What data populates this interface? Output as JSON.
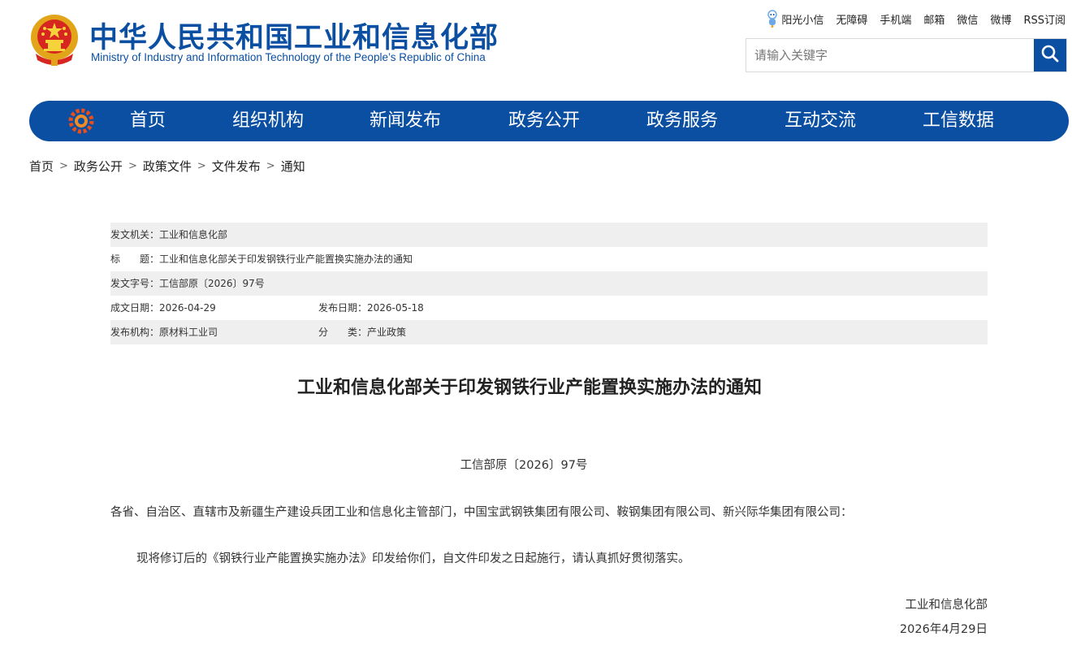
{
  "header": {
    "title": "中华人民共和国工业和信息化部",
    "subtitle": "Ministry of Industry and Information Technology of the People’s Republic of China",
    "toplinks": [
      "阳光小信",
      "无障碍",
      "手机端",
      "邮箱",
      "微信",
      "微博",
      "RSS订阅"
    ],
    "search_placeholder": "请输入关键字",
    "brand_color": "#0b4fa3"
  },
  "nav": {
    "items": [
      "首页",
      "组织机构",
      "新闻发布",
      "政务公开",
      "政务服务",
      "互动交流",
      "工信数据"
    ]
  },
  "breadcrumb": [
    "首页",
    "政务公开",
    "政策文件",
    "文件发布",
    "通知"
  ],
  "breadcrumb_separator": ">",
  "meta": {
    "issuer": "发文机关：工业和信息化部",
    "title": "标　　题：工业和信息化部关于印发钢铁行业产能置换实施办法的通知",
    "doc_no": "发文字号：工信部原〔2026〕97号",
    "created": "成文日期：2026-04-29",
    "published": "发布日期：2026-05-18",
    "org": "发布机构：原材料工业司",
    "category": "分　　类：产业政策"
  },
  "document": {
    "title": "工业和信息化部关于印发钢铁行业产能置换实施办法的通知",
    "number": "工信部原〔2026〕97号",
    "recipients": "各省、自治区、直辖市及新疆生产建设兵团工业和信息化主管部门，中国宝武钢铁集团有限公司、鞍钢集团有限公司、新兴际华集团有限公司：",
    "body": "现将修订后的《钢铁行业产能置换实施办法》印发给你们，自文件印发之日起施行，请认真抓好贯彻落实。",
    "signature": "工业和信息化部",
    "date": "2026年4月29日"
  }
}
